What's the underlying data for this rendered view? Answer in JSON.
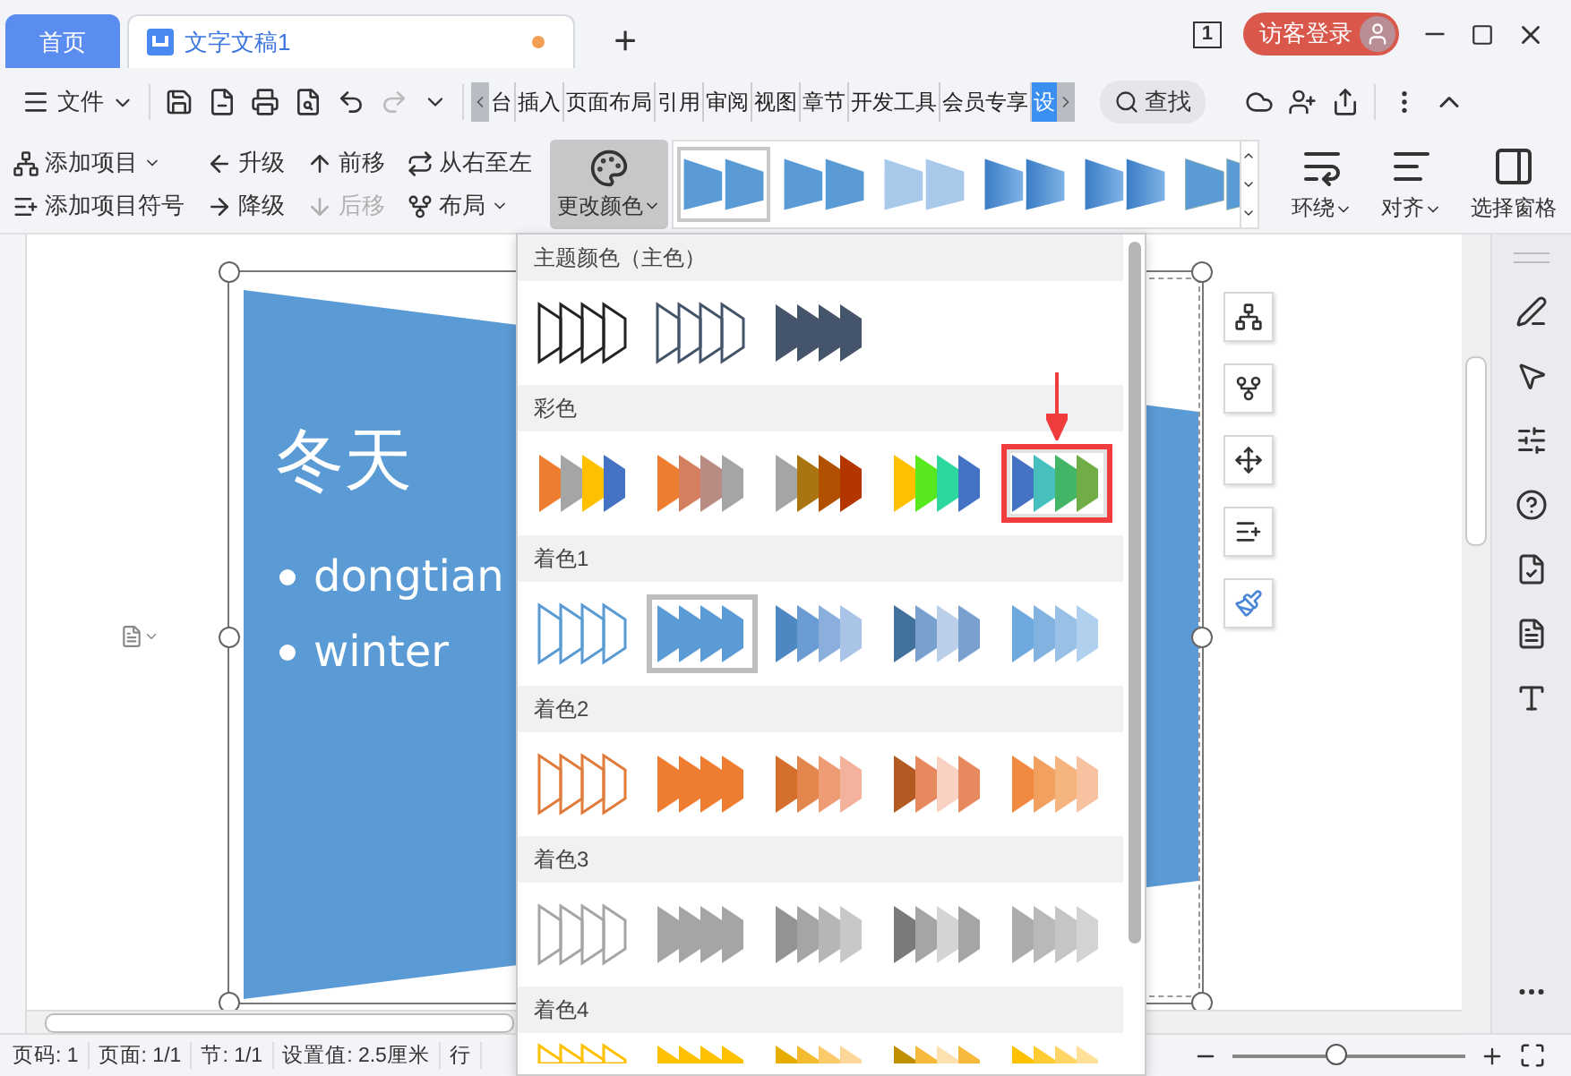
{
  "tabs": [
    {
      "label": "首页",
      "kind": "home",
      "selected": false
    },
    {
      "label": "文字文稿1",
      "kind": "document",
      "selected": true,
      "unsaved": true
    }
  ],
  "add_tab": "+",
  "page_count": "1",
  "account": {
    "label": "访客登录"
  },
  "menu": {
    "file": "文件",
    "search": "查找",
    "ribbon_tabs": [
      {
        "label": "台",
        "selected": false
      },
      {
        "label": "插入",
        "selected": false
      },
      {
        "label": "页面布局",
        "selected": false
      },
      {
        "label": "引用",
        "selected": false
      },
      {
        "label": "审阅",
        "selected": false
      },
      {
        "label": "视图",
        "selected": false
      },
      {
        "label": "章节",
        "selected": false
      },
      {
        "label": "开发工具",
        "selected": false
      },
      {
        "label": "会员专享",
        "selected": false
      },
      {
        "label": "设",
        "selected": true
      }
    ]
  },
  "ribbon": {
    "commands": [
      {
        "label": "添加项目",
        "dropdown": true,
        "disabled": false
      },
      {
        "label": "升级",
        "dropdown": false,
        "disabled": false
      },
      {
        "label": "前移",
        "dropdown": false,
        "disabled": false
      },
      {
        "label": "从右至左",
        "dropdown": false,
        "disabled": false
      },
      {
        "label": "添加项目符号",
        "dropdown": false,
        "disabled": false
      },
      {
        "label": "降级",
        "dropdown": false,
        "disabled": false
      },
      {
        "label": "后移",
        "dropdown": false,
        "disabled": true
      },
      {
        "label": "布局",
        "dropdown": true,
        "disabled": false
      }
    ],
    "change_color": {
      "label": "更改颜色",
      "pressed": true,
      "dropdown": true
    },
    "styles": [
      {
        "kind": "solid",
        "selected": true
      },
      {
        "kind": "solid",
        "selected": false
      },
      {
        "kind": "faded",
        "selected": false
      },
      {
        "kind": "gradient",
        "selected": false
      },
      {
        "kind": "gradient",
        "selected": false
      },
      {
        "kind": "shadow",
        "selected": false
      }
    ],
    "arrange": [
      {
        "label": "环绕",
        "dropdown": true
      },
      {
        "label": "对齐",
        "dropdown": true
      },
      {
        "label": "选择窗格",
        "dropdown": false
      }
    ]
  },
  "slide": {
    "title": "冬天",
    "bullets": [
      "dongtian",
      "winter"
    ]
  },
  "color_menu": {
    "sections": [
      {
        "title": "主题颜色（主色）",
        "options": [
          {
            "kind": "outline",
            "selected": false,
            "highlighted": false,
            "shapes": [
              {
                "color": "#222222"
              },
              {
                "color": "#222222"
              },
              {
                "color": "#222222"
              },
              {
                "color": "#222222"
              }
            ]
          },
          {
            "kind": "outline",
            "selected": false,
            "highlighted": false,
            "shapes": [
              {
                "color": "#44546a"
              },
              {
                "color": "#44546a"
              },
              {
                "color": "#44546a"
              },
              {
                "color": "#44546a"
              }
            ]
          },
          {
            "kind": "fill",
            "selected": false,
            "highlighted": false,
            "shapes": [
              {
                "color": "#44546a"
              },
              {
                "color": "#44546a"
              },
              {
                "color": "#44546a"
              },
              {
                "color": "#44546a"
              }
            ]
          }
        ]
      },
      {
        "title": "彩色",
        "options": [
          {
            "kind": "fill",
            "selected": false,
            "highlighted": false,
            "shapes": [
              {
                "color": "#ed7d31"
              },
              {
                "color": "#a5a5a5"
              },
              {
                "color": "#ffc000"
              },
              {
                "color": "#4472c4"
              }
            ]
          },
          {
            "kind": "fill",
            "selected": false,
            "highlighted": false,
            "shapes": [
              {
                "color": "#ed7d31"
              },
              {
                "color": "#d47f60"
              },
              {
                "color": "#b98b82"
              },
              {
                "color": "#a5a5a5"
              }
            ]
          },
          {
            "kind": "fill",
            "selected": false,
            "highlighted": false,
            "shapes": [
              {
                "color": "#a5a5a5"
              },
              {
                "color": "#a87510"
              },
              {
                "color": "#b05000"
              },
              {
                "color": "#b33500"
              }
            ]
          },
          {
            "kind": "fill",
            "selected": false,
            "highlighted": false,
            "shapes": [
              {
                "color": "#ffc000"
              },
              {
                "color": "#58e81e"
              },
              {
                "color": "#2ed6a0"
              },
              {
                "color": "#4472c4"
              }
            ]
          },
          {
            "kind": "fill",
            "selected": false,
            "highlighted": true,
            "shapes": [
              {
                "color": "#4472c4"
              },
              {
                "color": "#46bfbd"
              },
              {
                "color": "#42b566"
              },
              {
                "color": "#70ad47"
              }
            ]
          }
        ]
      },
      {
        "title": "着色1",
        "options": [
          {
            "kind": "outline",
            "selected": false,
            "highlighted": false,
            "shapes": [
              {
                "color": "#5b9bd5"
              },
              {
                "color": "#5b9bd5"
              },
              {
                "color": "#5b9bd5"
              },
              {
                "color": "#5b9bd5"
              }
            ]
          },
          {
            "kind": "fill",
            "selected": true,
            "highlighted": false,
            "shapes": [
              {
                "color": "#5b9bd5"
              },
              {
                "color": "#5b9bd5"
              },
              {
                "color": "#5b9bd5"
              },
              {
                "color": "#5b9bd5"
              }
            ]
          },
          {
            "kind": "fill",
            "selected": false,
            "highlighted": false,
            "shapes": [
              {
                "color": "#4e87c1"
              },
              {
                "color": "#6a9bd2"
              },
              {
                "color": "#8aafdc"
              },
              {
                "color": "#a9c4e6"
              }
            ]
          },
          {
            "kind": "fill",
            "selected": false,
            "highlighted": false,
            "shapes": [
              {
                "color": "#41719c"
              },
              {
                "color": "#7aa0cf"
              },
              {
                "color": "#bccfe9"
              },
              {
                "color": "#7aa0cf"
              }
            ]
          },
          {
            "kind": "fill",
            "selected": false,
            "highlighted": false,
            "shapes": [
              {
                "color": "#6fa8dc"
              },
              {
                "color": "#81b2e0"
              },
              {
                "color": "#99c0e6"
              },
              {
                "color": "#b1d0ee"
              }
            ]
          }
        ]
      },
      {
        "title": "着色2",
        "options": [
          {
            "kind": "outline",
            "selected": false,
            "highlighted": false,
            "shapes": [
              {
                "color": "#e07b39"
              },
              {
                "color": "#e07b39"
              },
              {
                "color": "#e07b39"
              },
              {
                "color": "#e07b39"
              }
            ]
          },
          {
            "kind": "fill",
            "selected": false,
            "highlighted": false,
            "shapes": [
              {
                "color": "#ed7d31"
              },
              {
                "color": "#ed7d31"
              },
              {
                "color": "#ed7d31"
              },
              {
                "color": "#ed7d31"
              }
            ]
          },
          {
            "kind": "fill",
            "selected": false,
            "highlighted": false,
            "shapes": [
              {
                "color": "#d46f2a"
              },
              {
                "color": "#e4874f"
              },
              {
                "color": "#ee9c75"
              },
              {
                "color": "#f3b29c"
              }
            ]
          },
          {
            "kind": "fill",
            "selected": false,
            "highlighted": false,
            "shapes": [
              {
                "color": "#b15a22"
              },
              {
                "color": "#e6895f"
              },
              {
                "color": "#f9d2c4"
              },
              {
                "color": "#e6895f"
              }
            ]
          },
          {
            "kind": "fill",
            "selected": false,
            "highlighted": false,
            "shapes": [
              {
                "color": "#f08a40"
              },
              {
                "color": "#f2a060"
              },
              {
                "color": "#f5b37e"
              },
              {
                "color": "#f7c29f"
              }
            ]
          }
        ]
      },
      {
        "title": "着色3",
        "options": [
          {
            "kind": "outline",
            "selected": false,
            "highlighted": false,
            "shapes": [
              {
                "color": "#a5a5a5"
              },
              {
                "color": "#a5a5a5"
              },
              {
                "color": "#a5a5a5"
              },
              {
                "color": "#a5a5a5"
              }
            ]
          },
          {
            "kind": "fill",
            "selected": false,
            "highlighted": false,
            "shapes": [
              {
                "color": "#a5a5a5"
              },
              {
                "color": "#a5a5a5"
              },
              {
                "color": "#a5a5a5"
              },
              {
                "color": "#a5a5a5"
              }
            ]
          },
          {
            "kind": "fill",
            "selected": false,
            "highlighted": false,
            "shapes": [
              {
                "color": "#939393"
              },
              {
                "color": "#a5a5a5"
              },
              {
                "color": "#b6b6b6"
              },
              {
                "color": "#c8c8c8"
              }
            ]
          },
          {
            "kind": "fill",
            "selected": false,
            "highlighted": false,
            "shapes": [
              {
                "color": "#7a7a7a"
              },
              {
                "color": "#a5a5a5"
              },
              {
                "color": "#d4d4d4"
              },
              {
                "color": "#a5a5a5"
              }
            ]
          },
          {
            "kind": "fill",
            "selected": false,
            "highlighted": false,
            "shapes": [
              {
                "color": "#acacac"
              },
              {
                "color": "#b9b9b9"
              },
              {
                "color": "#c5c5c5"
              },
              {
                "color": "#d3d3d3"
              }
            ]
          }
        ]
      },
      {
        "title": "着色4",
        "options": [
          {
            "kind": "outline",
            "selected": false,
            "highlighted": false,
            "shapes": [
              {
                "color": "#ffc000"
              },
              {
                "color": "#ffc000"
              },
              {
                "color": "#ffc000"
              },
              {
                "color": "#ffc000"
              }
            ]
          },
          {
            "kind": "fill",
            "selected": false,
            "highlighted": false,
            "shapes": [
              {
                "color": "#ffc000"
              },
              {
                "color": "#ffc000"
              },
              {
                "color": "#ffc000"
              },
              {
                "color": "#ffc000"
              }
            ]
          },
          {
            "kind": "fill",
            "selected": false,
            "highlighted": false,
            "shapes": [
              {
                "color": "#e6ad00"
              },
              {
                "color": "#f5bb30"
              },
              {
                "color": "#fccb69"
              },
              {
                "color": "#fdd79a"
              }
            ]
          },
          {
            "kind": "fill",
            "selected": false,
            "highlighted": false,
            "shapes": [
              {
                "color": "#bf8f00"
              },
              {
                "color": "#f6b93b"
              },
              {
                "color": "#fde0b0"
              },
              {
                "color": "#f6b93b"
              }
            ]
          },
          {
            "kind": "fill",
            "selected": false,
            "highlighted": false,
            "shapes": [
              {
                "color": "#ffc000"
              },
              {
                "color": "#ffcb33"
              },
              {
                "color": "#ffd666"
              },
              {
                "color": "#ffe099"
              }
            ]
          }
        ]
      }
    ]
  },
  "status_bar": {
    "items": [
      "页码: 1",
      "页面: 1/1",
      "节: 1/1",
      "设置值: 2.5厘米",
      "行"
    ],
    "zoom": {
      "level": 0.45
    }
  }
}
